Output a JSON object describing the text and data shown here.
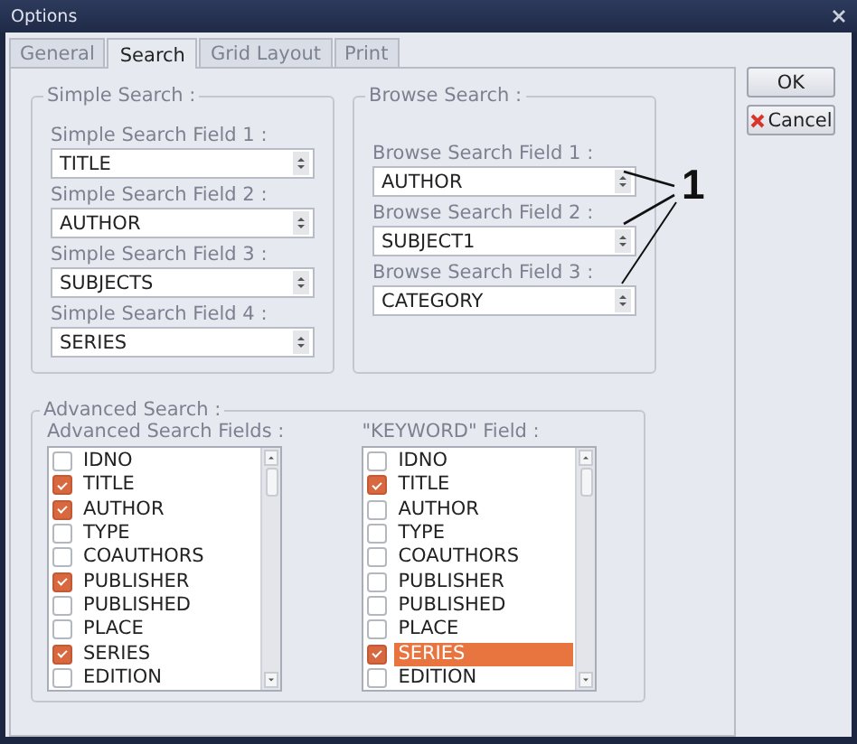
{
  "window": {
    "title": "Options"
  },
  "tabs": [
    {
      "label": "General",
      "selected": false
    },
    {
      "label": "Search",
      "selected": true
    },
    {
      "label": "Grid Layout",
      "selected": false
    },
    {
      "label": "Print",
      "selected": false
    }
  ],
  "simple_search": {
    "title": "Simple Search :",
    "fields": [
      {
        "label": "Simple Search Field 1 :",
        "value": "TITLE"
      },
      {
        "label": "Simple Search Field 2 :",
        "value": "AUTHOR"
      },
      {
        "label": "Simple Search Field 3 :",
        "value": "SUBJECTS"
      },
      {
        "label": "Simple Search Field 4 :",
        "value": "SERIES"
      }
    ]
  },
  "browse_search": {
    "title": "Browse Search :",
    "fields": [
      {
        "label": "Browse Search Field 1 :",
        "value": "AUTHOR"
      },
      {
        "label": "Browse Search Field 2 :",
        "value": "SUBJECT1"
      },
      {
        "label": "Browse Search Field 3 :",
        "value": "CATEGORY"
      }
    ]
  },
  "annotation": {
    "label": "1"
  },
  "advanced_search": {
    "title": "Advanced Search :",
    "lists": [
      {
        "title": "Advanced Search Fields :",
        "items": [
          {
            "label": "IDNO",
            "checked": false,
            "selected": false
          },
          {
            "label": "TITLE",
            "checked": true,
            "selected": false
          },
          {
            "label": "AUTHOR",
            "checked": true,
            "selected": false
          },
          {
            "label": "TYPE",
            "checked": false,
            "selected": false
          },
          {
            "label": "COAUTHORS",
            "checked": false,
            "selected": false
          },
          {
            "label": "PUBLISHER",
            "checked": true,
            "selected": false
          },
          {
            "label": "PUBLISHED",
            "checked": false,
            "selected": false
          },
          {
            "label": "PLACE",
            "checked": false,
            "selected": false
          },
          {
            "label": "SERIES",
            "checked": true,
            "selected": false
          },
          {
            "label": "EDITION",
            "checked": false,
            "selected": false
          }
        ]
      },
      {
        "title": "\"KEYWORD\" Field :",
        "items": [
          {
            "label": "IDNO",
            "checked": false,
            "selected": false
          },
          {
            "label": "TITLE",
            "checked": true,
            "selected": false
          },
          {
            "label": "AUTHOR",
            "checked": false,
            "selected": false
          },
          {
            "label": "TYPE",
            "checked": false,
            "selected": false
          },
          {
            "label": "COAUTHORS",
            "checked": false,
            "selected": false
          },
          {
            "label": "PUBLISHER",
            "checked": false,
            "selected": false
          },
          {
            "label": "PUBLISHED",
            "checked": false,
            "selected": false
          },
          {
            "label": "PLACE",
            "checked": false,
            "selected": false
          },
          {
            "label": "SERIES",
            "checked": true,
            "selected": true
          },
          {
            "label": "EDITION",
            "checked": false,
            "selected": false
          }
        ]
      }
    ]
  },
  "buttons": [
    {
      "label": "OK",
      "kind": "ok"
    },
    {
      "label": "Cancel",
      "kind": "cancel"
    }
  ]
}
